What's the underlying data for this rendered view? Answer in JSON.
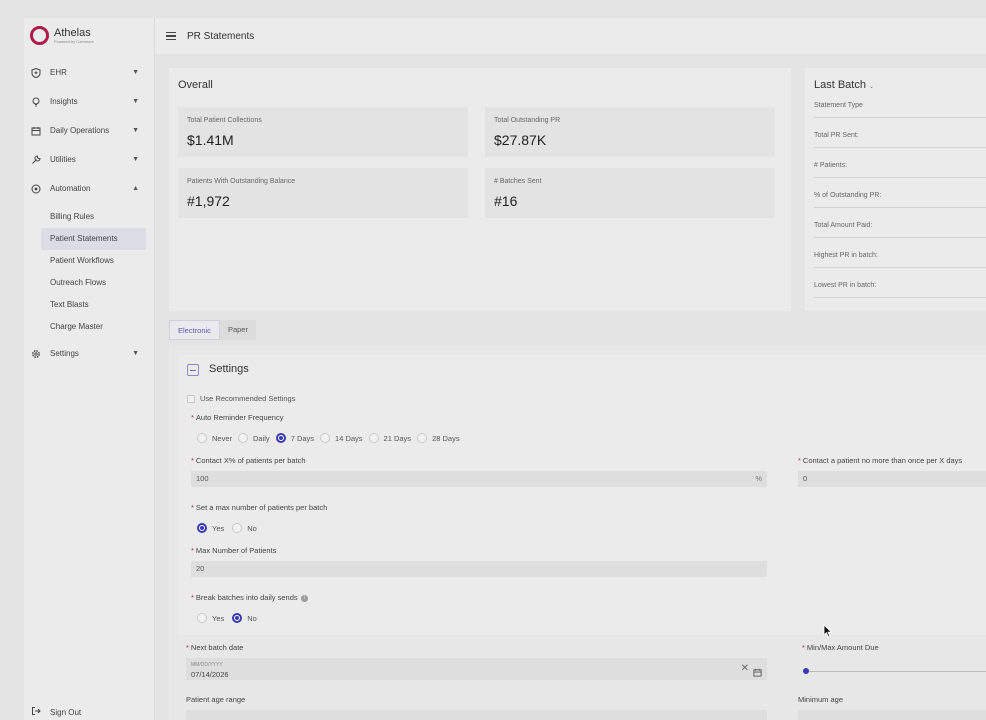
{
  "brand": {
    "name": "Athelas",
    "tagline": "Powered by Commure"
  },
  "sidebar": {
    "items": [
      {
        "label": "EHR",
        "icon": "shield-icon"
      },
      {
        "label": "Insights",
        "icon": "bulb-icon"
      },
      {
        "label": "Daily Operations",
        "icon": "calendar-icon"
      },
      {
        "label": "Utilities",
        "icon": "wrench-icon"
      },
      {
        "label": "Automation",
        "icon": "automation-icon"
      }
    ],
    "automation_sub": [
      "Billing Rules",
      "Patient Statements",
      "Patient Workflows",
      "Outreach Flows",
      "Text Blasts",
      "Charge Master"
    ],
    "settings_label": "Settings",
    "signout_label": "Sign Out"
  },
  "header": {
    "title": "PR Statements"
  },
  "overall": {
    "title": "Overall",
    "stats": [
      {
        "label": "Total Patient Collections",
        "value": "$1.41M"
      },
      {
        "label": "Total Outstanding PR",
        "value": "$27.87K"
      },
      {
        "label": "Patients With Outstanding Balance",
        "value": "#1,972"
      },
      {
        "label": "# Batches Sent",
        "value": "#16"
      }
    ]
  },
  "last_batch": {
    "title": "Last Batch",
    "rows": [
      "Statement Type",
      "Total PR Sent:",
      "# Patients:",
      "% of Outstanding PR:",
      "Total Amount Paid:",
      "Highest PR in batch:",
      "Lowest PR in batch:"
    ]
  },
  "tabs": [
    {
      "label": "Electronic"
    },
    {
      "label": "Paper"
    }
  ],
  "settings": {
    "title": "Settings",
    "use_recommended": "Use Recommended Settings",
    "reminder": {
      "label": "Auto Reminder Frequency",
      "options": [
        "Never",
        "Daily",
        "7 Days",
        "14 Days",
        "21 Days",
        "28 Days"
      ],
      "selected": "7 Days"
    },
    "contact_pct": {
      "label": "Contact X% of patients per batch",
      "value": "100",
      "suffix": "%"
    },
    "contact_once": {
      "label": "Contact a patient no more than once per X days",
      "value": "0"
    },
    "max_toggle": {
      "label": "Set a max number of patients per batch",
      "options": [
        "Yes",
        "No"
      ],
      "selected": "Yes"
    },
    "max_patients": {
      "label": "Max Number of Patients",
      "value": "20"
    },
    "break_batches": {
      "label": "Break batches into daily sends",
      "options": [
        "Yes",
        "No"
      ],
      "selected": "No"
    },
    "next_batch": {
      "label": "Next batch date",
      "placeholder": "MM/DD/YYYY",
      "value": "07/14/2026"
    },
    "min_max_due": {
      "label": "Min/Max Amount Due"
    },
    "age_range": {
      "label": "Patient age range"
    },
    "min_age": {
      "label": "Minimum age"
    }
  }
}
